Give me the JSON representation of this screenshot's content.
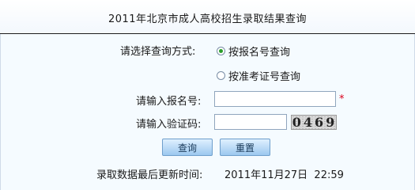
{
  "title": "2011年北京市成人高校招生录取结果查询",
  "query_method": {
    "label": "请选择查询方式:",
    "options": [
      {
        "label": "按报名号查询",
        "selected": true
      },
      {
        "label": "按准考证号查询",
        "selected": false
      }
    ]
  },
  "registration": {
    "label": "请输入报名号:",
    "value": "",
    "required_mark": "*"
  },
  "captcha": {
    "label": "请输入验证码:",
    "value": "",
    "image_text": "0469"
  },
  "buttons": {
    "query": "查询",
    "reset": "重置"
  },
  "last_update": {
    "label": "录取数据最后更新时间:",
    "value": "2011年11月27日  22:59"
  },
  "colors": {
    "background": "#f5fbff",
    "button_top": "#dff0ff",
    "button_bottom": "#9cc8ef",
    "radio_selected": "#2a9d2a",
    "required": "#d9001b"
  }
}
